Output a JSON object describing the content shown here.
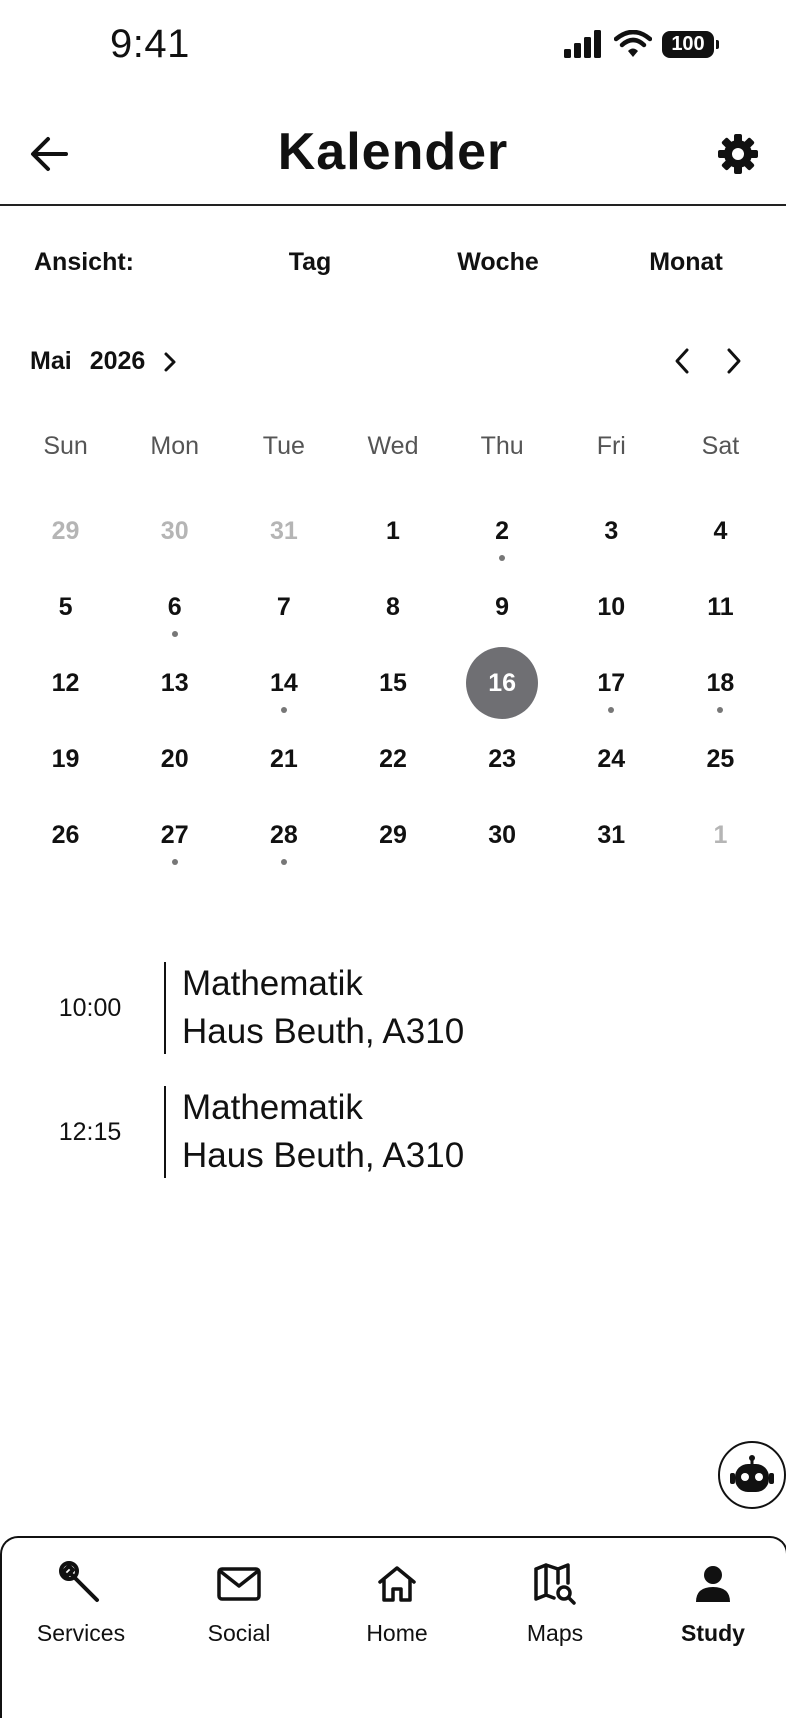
{
  "status_bar": {
    "time": "9:41",
    "battery": "100"
  },
  "header": {
    "title": "Kalender"
  },
  "view_selector": {
    "label": "Ansicht:",
    "options": [
      "Tag",
      "Woche",
      "Monat"
    ]
  },
  "calendar": {
    "month": "Mai",
    "year": "2026",
    "weekdays": [
      "Sun",
      "Mon",
      "Tue",
      "Wed",
      "Thu",
      "Fri",
      "Sat"
    ],
    "days": [
      {
        "n": "29",
        "m": true
      },
      {
        "n": "30",
        "m": true
      },
      {
        "n": "31",
        "m": true
      },
      {
        "n": "1"
      },
      {
        "n": "2",
        "e": true
      },
      {
        "n": "3"
      },
      {
        "n": "4"
      },
      {
        "n": "5"
      },
      {
        "n": "6",
        "e": true
      },
      {
        "n": "7"
      },
      {
        "n": "8"
      },
      {
        "n": "9"
      },
      {
        "n": "10"
      },
      {
        "n": "11"
      },
      {
        "n": "12"
      },
      {
        "n": "13"
      },
      {
        "n": "14",
        "e": true
      },
      {
        "n": "15"
      },
      {
        "n": "16",
        "s": true
      },
      {
        "n": "17",
        "e": true
      },
      {
        "n": "18",
        "e": true
      },
      {
        "n": "19"
      },
      {
        "n": "20"
      },
      {
        "n": "21"
      },
      {
        "n": "22"
      },
      {
        "n": "23"
      },
      {
        "n": "24"
      },
      {
        "n": "25"
      },
      {
        "n": "26"
      },
      {
        "n": "27",
        "e": true
      },
      {
        "n": "28",
        "e": true
      },
      {
        "n": "29"
      },
      {
        "n": "30"
      },
      {
        "n": "31"
      },
      {
        "n": "1",
        "m": true
      }
    ]
  },
  "events": [
    {
      "time": "10:00",
      "title": "Mathematik",
      "room": "Haus Beuth, A310"
    },
    {
      "time": "12:15",
      "title": "Mathematik",
      "room": "Haus Beuth, A310"
    }
  ],
  "bottom_nav": {
    "items": [
      {
        "label": "Services",
        "icon": "wrench-icon"
      },
      {
        "label": "Social",
        "icon": "mail-icon"
      },
      {
        "label": "Home",
        "icon": "home-icon"
      },
      {
        "label": "Maps",
        "icon": "map-search-icon"
      },
      {
        "label": "Study",
        "icon": "person-icon",
        "active": true
      }
    ]
  },
  "colors": {
    "selected_day": "#6f6f73",
    "muted_day": "#b5b5b5",
    "event_dot": "#777777"
  }
}
